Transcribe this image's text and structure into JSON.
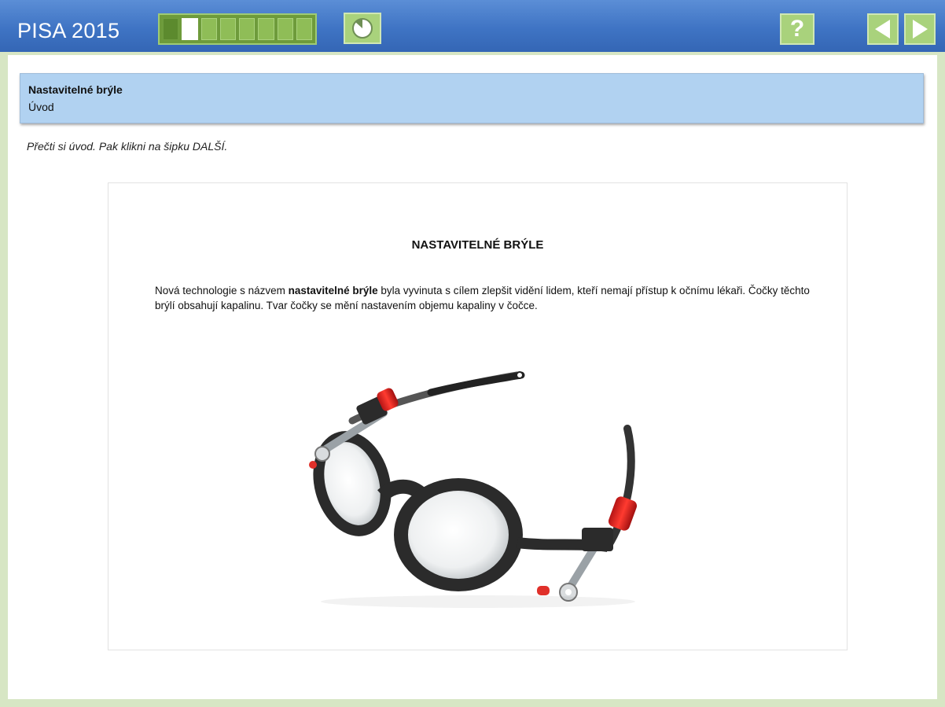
{
  "app": {
    "title": "PISA 2015"
  },
  "toolbar": {
    "progress": {
      "total_segments": 8,
      "current_segment": 2
    },
    "timer_icon": "clock-icon",
    "help_label": "?",
    "prev_icon": "arrow-left-icon",
    "next_icon": "arrow-right-icon"
  },
  "unit": {
    "title": "Nastavitelné brýle",
    "subtitle": "Úvod"
  },
  "instruction": "Přečti si úvod. Pak klikni na šipku DALŠÍ.",
  "stimulus": {
    "heading": "NASTAVITELNÉ BRÝLE",
    "text_before": "Nová technologie s názvem ",
    "text_bold": "nastavitelné brýle",
    "text_after": " byla vyvinuta s cílem zlepšit vidění lidem, kteří nemají přístup k očnímu lékaři. Čočky těchto brýlí obsahují kapalinu. Tvar čočky se mění nastavením objemu kapaliny v čočce.",
    "image_icon": "adjustable-glasses-image"
  },
  "colors": {
    "topbar": "#3f74c4",
    "accent_green": "#a9d27c",
    "header_blue": "#b1d2f1",
    "frame_green": "#d7e6c4"
  }
}
